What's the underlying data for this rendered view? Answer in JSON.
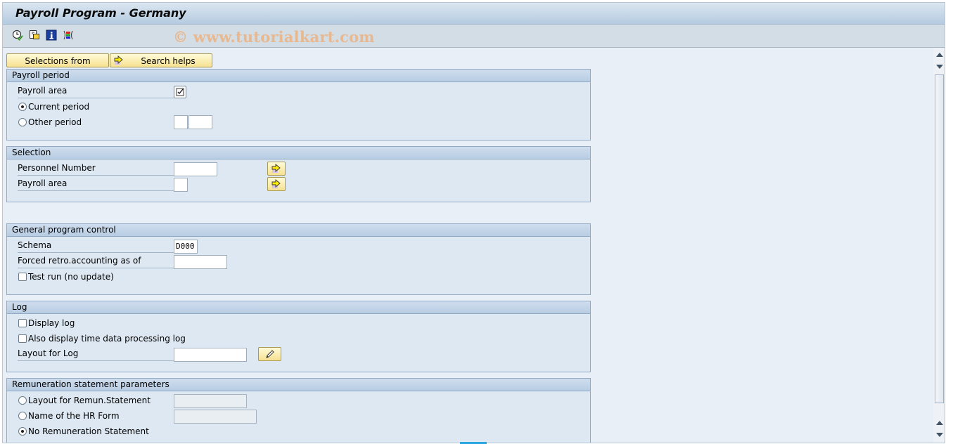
{
  "window": {
    "title": "Payroll Program - Germany"
  },
  "toolbar": {
    "icons": [
      {
        "name": "execute-icon",
        "tooltip": "Execute"
      },
      {
        "name": "get-variant-icon",
        "tooltip": "Get Variant"
      },
      {
        "name": "info-icon",
        "tooltip": "Program Documentation"
      },
      {
        "name": "selection-options-icon",
        "tooltip": "Selection Options"
      }
    ],
    "watermark": "© www.tutorialkart.com"
  },
  "actions": {
    "selections_from": "Selections from",
    "search_helps": "Search helps"
  },
  "groups": {
    "payroll_period": {
      "title": "Payroll period",
      "payroll_area_label": "Payroll area",
      "payroll_area_checked": true,
      "current_period_label": "Current period",
      "current_period_selected": true,
      "other_period_label": "Other period",
      "other_period_selected": false,
      "other_period_value1": "",
      "other_period_value2": ""
    },
    "selection": {
      "title": "Selection",
      "personnel_number_label": "Personnel Number",
      "personnel_number_value": "",
      "payroll_area_label": "Payroll area",
      "payroll_area_value": ""
    },
    "general": {
      "title": "General program control",
      "schema_label": "Schema",
      "schema_value": "D000",
      "forced_retro_label": "Forced retro.accounting as of",
      "forced_retro_value": "",
      "test_run_label": "Test run (no update)",
      "test_run_checked": false
    },
    "log": {
      "title": "Log",
      "display_log_label": "Display log",
      "display_log_checked": false,
      "time_log_label": "Also display time data processing log",
      "time_log_checked": false,
      "layout_label": "Layout for Log",
      "layout_value": ""
    },
    "remuneration": {
      "title": "Remuneration statement parameters",
      "layout_label": "Layout for Remun.Statement",
      "layout_value": "",
      "hr_form_label": "Name of the HR Form",
      "hr_form_value": "",
      "none_label": "No Remuneration Statement",
      "selected": "none"
    }
  },
  "colors": {
    "button_yellow": "#f6e190",
    "panel_blue": "#dde8f2",
    "header_blue": "#b8cde3"
  }
}
